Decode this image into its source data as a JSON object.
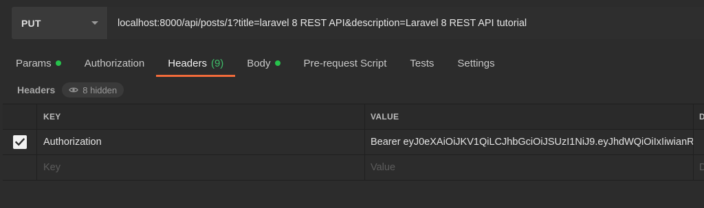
{
  "request": {
    "method": "PUT",
    "url": "localhost:8000/api/posts/1?title=laravel 8 REST API&description=Laravel 8 REST API tutorial"
  },
  "tabs": [
    {
      "label": "Params",
      "dot": true
    },
    {
      "label": "Authorization"
    },
    {
      "label": "Headers",
      "count": "(9)",
      "active": true
    },
    {
      "label": "Body",
      "dot": true
    },
    {
      "label": "Pre-request Script"
    },
    {
      "label": "Tests"
    },
    {
      "label": "Settings"
    }
  ],
  "headers_section": {
    "title": "Headers",
    "hidden_label": "8 hidden"
  },
  "table": {
    "columns": {
      "key": "KEY",
      "value": "VALUE",
      "description": "D"
    },
    "rows": [
      {
        "checked": true,
        "key": "Authorization",
        "value": "Bearer eyJ0eXAiOiJKV1QiLCJhbGciOiJSUzI1NiJ9.eyJhdWQiOiIxIiwianR"
      }
    ],
    "placeholders": {
      "key": "Key",
      "value": "Value",
      "description": "D"
    }
  },
  "colors": {
    "active_tab_underline": "#f26b3a",
    "status_dot": "#27c24c",
    "count_text": "#3fbf6a"
  }
}
